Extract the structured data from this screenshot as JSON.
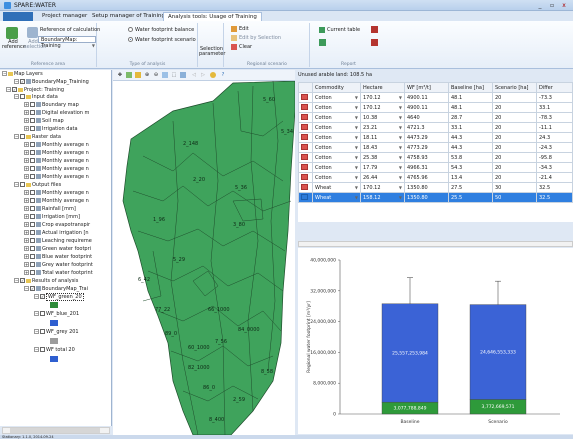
{
  "window": {
    "title": "SPARE:WATER",
    "min": "_",
    "max": "▫",
    "close": "x"
  },
  "menu": {
    "file": "",
    "tabs": [
      "Project manager",
      "Setup manager of Training",
      "Analysis tools: Usage of Training"
    ]
  },
  "ribbon": {
    "add_ref": "Add reference",
    "add_sel": "Add selection",
    "ref_calc": "Reference of calculation",
    "boundary_label": "BoundaryMap: Training",
    "ref_group": "Reference area",
    "wf_balance": "Water footprint balance",
    "wf_scenario": "Water footprint scenario",
    "type_group": "Type of analysis",
    "sel_params": "Selection parameter",
    "edit": "Edit",
    "edit_sel": "Edit by Selection",
    "clear": "Clear",
    "scen_group": "Regional scenario",
    "current_table": "Current table",
    "report_group": "Report"
  },
  "tree": {
    "map_layers": "Map Layers",
    "boundary": "BoundaryMap_Training",
    "project": "Project: Training",
    "input_data": "Input data",
    "inputs": [
      "Boundary map",
      "Digital elevation m",
      "Soil map",
      "Irrigation data"
    ],
    "raster_data": "Raster data",
    "rasters": [
      "Monthly average n",
      "Monthly average n",
      "Monthly average n",
      "Monthly average n",
      "Monthly average n"
    ],
    "output_files": "Output files",
    "outputs": [
      "Monthly average n",
      "Monthly average n",
      "Rainfall [mm]",
      "Irrigation [mm]",
      "Crop evapotranspir",
      "Actual irrigation [n",
      "Leaching requireme",
      "Green water footpri",
      "Blue water footprint",
      "Grey water footprint",
      "Total water footprint"
    ],
    "results": "Results of analysis",
    "result_map": "BoundaryMap_Trai",
    "wf_green": "WF_green_20",
    "wf_blue": "WF_blue_201",
    "wf_grey": "WF_grey 201",
    "wf_total": "WF total 20",
    "swatch_colors": [
      "#2e8b3a",
      "#2f5fd0",
      "#9c9c9c",
      "#2f5fd0"
    ]
  },
  "statusbar": "Stationary: 1.1.0, 2014-09-24",
  "grid": {
    "info": "Unused arable land: 108.5 ha",
    "headers": [
      "Commodity",
      "Hectare",
      "WF [m³/t]",
      "Baseline [ha]",
      "Scenario [ha]",
      "Differ"
    ],
    "rows": [
      [
        "Cotton",
        "170.12",
        "4900.11",
        "48.1",
        "20",
        "-73.3"
      ],
      [
        "Cotton",
        "170.12",
        "4900.11",
        "48.1",
        "20",
        "33.1"
      ],
      [
        "Cotton",
        "10.38",
        "4640",
        "28.7",
        "20",
        "-78.3"
      ],
      [
        "Cotton",
        "23.21",
        "4721.3",
        "33.1",
        "20",
        "-11.1"
      ],
      [
        "Cotton",
        "18.11",
        "4473.29",
        "44.3",
        "20",
        "24.3"
      ],
      [
        "Cotton",
        "18.43",
        "4773.29",
        "44.3",
        "20",
        "-24.3"
      ],
      [
        "Cotton",
        "25.38",
        "4758.93",
        "53.8",
        "20",
        "-95.8"
      ],
      [
        "Cotton",
        "17.79",
        "4966.31",
        "54.3",
        "20",
        "-34.3"
      ],
      [
        "Cotton",
        "26.44",
        "4765.96",
        "13.4",
        "20",
        "-21.4"
      ],
      [
        "Wheat",
        "170.12",
        "1350.80",
        "27.5",
        "30",
        "32.5"
      ],
      [
        "Wheat",
        "158.12",
        "1350.80",
        "25.5",
        "50",
        "32.5"
      ]
    ]
  },
  "chart_data": {
    "type": "bar",
    "stacked": true,
    "ylabel": "Regional water footprint [m³/yr]",
    "ylim": [
      0,
      40000000
    ],
    "yticks": [
      "0",
      "8,000,000",
      "16,000,000",
      "24,000,000",
      "32,000,000",
      "40,000,000"
    ],
    "categories": [
      "Baseline",
      "Scenario"
    ],
    "series": [
      {
        "values": [
          3077788849,
          3772669571
        ],
        "labels": [
          "3,077,788,849",
          "3,772,669,571"
        ],
        "color": "#2e9a3a",
        "display_values": [
          3077788,
          3772669
        ]
      },
      {
        "values": [
          25557253984,
          24646553333
        ],
        "labels": [
          "25,557,253,984",
          "24,646,553,333"
        ],
        "color": "#3b63d6",
        "display_values": [
          25557253,
          24646553
        ]
      }
    ],
    "error_top": [
      35400000,
      34500000
    ]
  },
  "map_labels": [
    "5_60",
    "5_34",
    "2_148",
    "2_20",
    "5_36",
    "3_80",
    "5_29",
    "77_22",
    "66_1000",
    "89_0",
    "84_0000",
    "7_56",
    "60_1000",
    "82_1000",
    "8_58",
    "86_0",
    "2_59",
    "8_400",
    "6_42",
    "1_96"
  ]
}
